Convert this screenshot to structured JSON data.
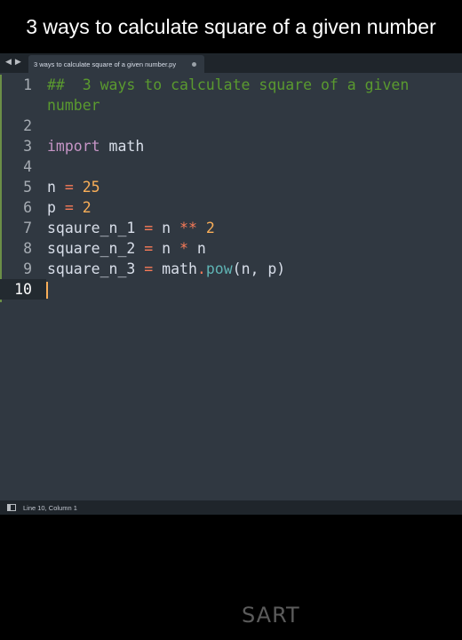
{
  "video_title": "3 ways to calculate square of a given number",
  "tab_bar": {
    "back_arrow": "◀",
    "forward_arrow": "▶",
    "active_tab_label": "3 ways to calculate square of a given number.py",
    "active_tab_unsaved": true
  },
  "code_lines": [
    {
      "number": "1",
      "tokens": [
        {
          "text": "##  3 ways to calculate square of a given",
          "type": "comment"
        }
      ]
    },
    {
      "number": "",
      "tokens": [
        {
          "text": "number",
          "type": "comment"
        }
      ]
    },
    {
      "number": "2",
      "tokens": []
    },
    {
      "number": "3",
      "tokens": [
        {
          "text": "import",
          "type": "keyword"
        },
        {
          "text": " math",
          "type": "ident"
        }
      ]
    },
    {
      "number": "4",
      "tokens": []
    },
    {
      "number": "5",
      "tokens": [
        {
          "text": "n ",
          "type": "ident"
        },
        {
          "text": "=",
          "type": "op"
        },
        {
          "text": " ",
          "type": "ident"
        },
        {
          "text": "25",
          "type": "num"
        }
      ]
    },
    {
      "number": "6",
      "tokens": [
        {
          "text": "p ",
          "type": "ident"
        },
        {
          "text": "=",
          "type": "op"
        },
        {
          "text": " ",
          "type": "ident"
        },
        {
          "text": "2",
          "type": "num"
        }
      ]
    },
    {
      "number": "7",
      "tokens": [
        {
          "text": "sqaure_n_1 ",
          "type": "ident"
        },
        {
          "text": "=",
          "type": "op"
        },
        {
          "text": " n ",
          "type": "ident"
        },
        {
          "text": "**",
          "type": "op"
        },
        {
          "text": " ",
          "type": "ident"
        },
        {
          "text": "2",
          "type": "num"
        }
      ]
    },
    {
      "number": "8",
      "tokens": [
        {
          "text": "square_n_2 ",
          "type": "ident"
        },
        {
          "text": "=",
          "type": "op"
        },
        {
          "text": " n ",
          "type": "ident"
        },
        {
          "text": "*",
          "type": "op"
        },
        {
          "text": " n",
          "type": "ident"
        }
      ]
    },
    {
      "number": "9",
      "tokens": [
        {
          "text": "square_n_3 ",
          "type": "ident"
        },
        {
          "text": "=",
          "type": "op"
        },
        {
          "text": " math",
          "type": "ident"
        },
        {
          "text": ".",
          "type": "op"
        },
        {
          "text": "pow",
          "type": "func"
        },
        {
          "text": "(n, p)",
          "type": "ident"
        }
      ]
    },
    {
      "number": "10",
      "tokens": [],
      "current": true
    }
  ],
  "status_bar": {
    "panel_icon": "panel-toggle-icon",
    "cursor_position": "Line 10, Column 1"
  },
  "watermark": "SART",
  "colors": {
    "editor_bg": "#303841",
    "comment": "#5a9a2f",
    "keyword": "#c695c6",
    "operator": "#f97b58",
    "number": "#f9ae58",
    "function": "#5fb4b4",
    "text": "#d8dee9"
  }
}
